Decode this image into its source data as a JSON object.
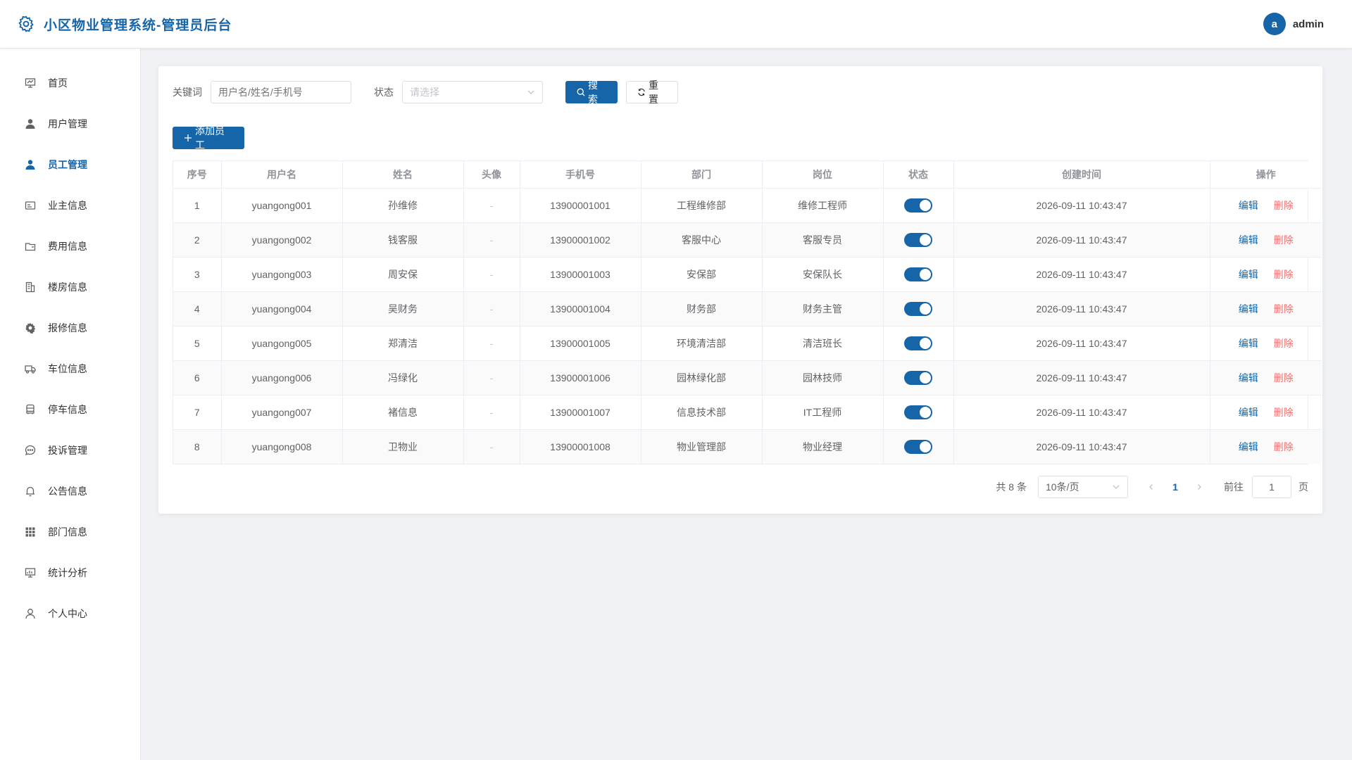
{
  "header": {
    "title": "小区物业管理系统-管理员后台",
    "user_initial": "a",
    "user_name": "admin"
  },
  "sidebar": {
    "items": [
      {
        "label": "首页",
        "icon": "presentation-icon"
      },
      {
        "label": "用户管理",
        "icon": "user-icon"
      },
      {
        "label": "员工管理",
        "icon": "user-icon",
        "active": true
      },
      {
        "label": "业主信息",
        "icon": "id-card-icon"
      },
      {
        "label": "费用信息",
        "icon": "folder-icon"
      },
      {
        "label": "楼房信息",
        "icon": "building-icon"
      },
      {
        "label": "报修信息",
        "icon": "gear-icon"
      },
      {
        "label": "车位信息",
        "icon": "truck-icon"
      },
      {
        "label": "停车信息",
        "icon": "car-icon"
      },
      {
        "label": "投诉管理",
        "icon": "chat-icon"
      },
      {
        "label": "公告信息",
        "icon": "bell-icon"
      },
      {
        "label": "部门信息",
        "icon": "grid-icon"
      },
      {
        "label": "统计分析",
        "icon": "chart-board-icon"
      },
      {
        "label": "个人中心",
        "icon": "person-outline-icon"
      }
    ]
  },
  "search": {
    "keyword_label": "关键词",
    "keyword_placeholder": "用户名/姓名/手机号",
    "status_label": "状态",
    "status_placeholder": "请选择",
    "search_button": "搜索",
    "reset_button": "重置"
  },
  "add_button": "添加员工",
  "table": {
    "columns": [
      "序号",
      "用户名",
      "姓名",
      "头像",
      "手机号",
      "部门",
      "岗位",
      "状态",
      "创建时间",
      "操作"
    ],
    "edit_label": "编辑",
    "delete_label": "删除",
    "rows": [
      {
        "no": "1",
        "username": "yuangong001",
        "name": "孙维修",
        "avatar": "-",
        "phone": "13900001001",
        "dept": "工程维修部",
        "post": "维修工程师",
        "enabled": true,
        "created": "2026-09-11 10:43:47"
      },
      {
        "no": "2",
        "username": "yuangong002",
        "name": "钱客服",
        "avatar": "-",
        "phone": "13900001002",
        "dept": "客服中心",
        "post": "客服专员",
        "enabled": true,
        "created": "2026-09-11 10:43:47"
      },
      {
        "no": "3",
        "username": "yuangong003",
        "name": "周安保",
        "avatar": "-",
        "phone": "13900001003",
        "dept": "安保部",
        "post": "安保队长",
        "enabled": true,
        "created": "2026-09-11 10:43:47"
      },
      {
        "no": "4",
        "username": "yuangong004",
        "name": "吴财务",
        "avatar": "-",
        "phone": "13900001004",
        "dept": "财务部",
        "post": "财务主管",
        "enabled": true,
        "created": "2026-09-11 10:43:47"
      },
      {
        "no": "5",
        "username": "yuangong005",
        "name": "郑清洁",
        "avatar": "-",
        "phone": "13900001005",
        "dept": "环境清洁部",
        "post": "清洁班长",
        "enabled": true,
        "created": "2026-09-11 10:43:47"
      },
      {
        "no": "6",
        "username": "yuangong006",
        "name": "冯绿化",
        "avatar": "-",
        "phone": "13900001006",
        "dept": "园林绿化部",
        "post": "园林技师",
        "enabled": true,
        "created": "2026-09-11 10:43:47"
      },
      {
        "no": "7",
        "username": "yuangong007",
        "name": "褚信息",
        "avatar": "-",
        "phone": "13900001007",
        "dept": "信息技术部",
        "post": "IT工程师",
        "enabled": true,
        "created": "2026-09-11 10:43:47"
      },
      {
        "no": "8",
        "username": "yuangong008",
        "name": "卫物业",
        "avatar": "-",
        "phone": "13900001008",
        "dept": "物业管理部",
        "post": "物业经理",
        "enabled": true,
        "created": "2026-09-11 10:43:47"
      }
    ]
  },
  "pagination": {
    "total_text": "共 8 条",
    "page_size": "10条/页",
    "current_page": "1",
    "goto_label": "前往",
    "goto_value": "1",
    "page_suffix": "页"
  },
  "colors": {
    "primary": "#1565a8",
    "danger": "#f56c6c",
    "background": "#f0f2f5"
  }
}
